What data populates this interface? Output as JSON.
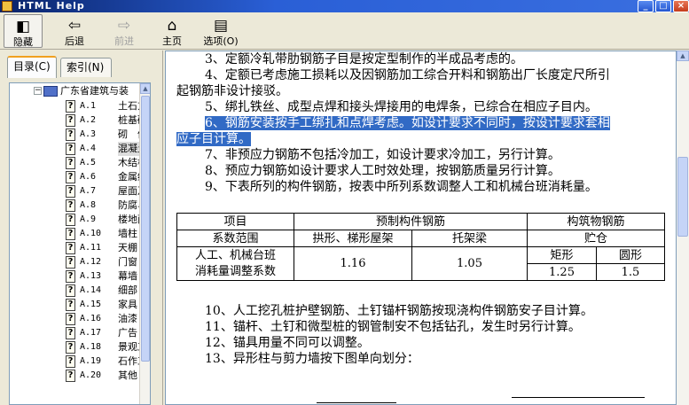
{
  "window": {
    "title": "HTML Help"
  },
  "toolbar": {
    "items": [
      {
        "label": "隐藏",
        "icon": "hide-pane-icon"
      },
      {
        "label": "后退",
        "icon": "back-arrow-icon"
      },
      {
        "label": "前进",
        "icon": "forward-arrow-icon"
      },
      {
        "label": "主页",
        "icon": "home-icon"
      },
      {
        "label": "选项(O)",
        "icon": "options-icon"
      }
    ]
  },
  "tabs": [
    "目录(C)",
    "索引(N)"
  ],
  "tree": {
    "root": "广东省建筑与装",
    "items": [
      {
        "code": "A.1",
        "name": "土石方"
      },
      {
        "code": "A.2",
        "name": "桩基础"
      },
      {
        "code": "A.3",
        "name": "砌　体"
      },
      {
        "code": "A.4",
        "name": "混凝土"
      },
      {
        "code": "A.5",
        "name": "木结构"
      },
      {
        "code": "A.6",
        "name": "金属结"
      },
      {
        "code": "A.7",
        "name": "屋面及"
      },
      {
        "code": "A.8",
        "name": "防腐与"
      },
      {
        "code": "A.9",
        "name": "楼地面"
      },
      {
        "code": "A.10",
        "name": "墙柱"
      },
      {
        "code": "A.11",
        "name": "天棚"
      },
      {
        "code": "A.12",
        "name": "门窗"
      },
      {
        "code": "A.13",
        "name": "幕墙"
      },
      {
        "code": "A.14",
        "name": "细部"
      },
      {
        "code": "A.15",
        "name": "家具"
      },
      {
        "code": "A.16",
        "name": "油漆"
      },
      {
        "code": "A.17",
        "name": "广告"
      },
      {
        "code": "A.18",
        "name": "景观工"
      },
      {
        "code": "A.19",
        "name": "石作工"
      },
      {
        "code": "A.20",
        "name": "其他"
      }
    ]
  },
  "content": {
    "paras": [
      "3、定额冷轧带肋钢筋子目是按定型制作的半成品考虑的。",
      "4、定额已考虑施工损耗以及因钢筋加工综合开料和钢筋出厂长度定尺所引",
      "起钢筋非设计接驳。",
      "5、绑扎铁丝、成型点焊和接头焊接用的电焊条，已综合在相应子目内。",
      "6、钢筋安装按手工绑扎和点焊考虑。如设计要求不同时，按设计要求套相",
      "应子目计算。",
      "7、非预应力钢筋不包括冷加工，如设计要求冷加工，另行计算。",
      "8、预应力钢筋如设计要求人工时效处理，按钢筋质量另行计算。",
      "9、下表所列的构件钢筋，按表中所列系数调整人工和机械台班消耗量。"
    ],
    "table": {
      "h1": "项目",
      "h2": "预制构件钢筋",
      "h3": "构筑物钢筋",
      "r1c1": "系数范围",
      "r1c2": "拱形、梯形屋架",
      "r1c3": "托架梁",
      "r1c4": "贮仓",
      "r2c4": "矩形",
      "r2c5": "圆形",
      "r3c1a": "人工、机械台班",
      "r3c1b": "消耗量调整系数",
      "v1": "1.16",
      "v2": "1.05",
      "v3": "1.25",
      "v4": "1.5"
    },
    "paras2": [
      "10、人工挖孔桩护壁钢筋、土钉锚杆钢筋按现浇构件钢筋安子目计算。",
      "11、锚杆、土钉和微型桩的钢管制安不包括钻孔，发生时另行计算。",
      "12、锚具用量不同可以调整。",
      "13、异形柱与剪力墙按下图单向划分："
    ]
  }
}
